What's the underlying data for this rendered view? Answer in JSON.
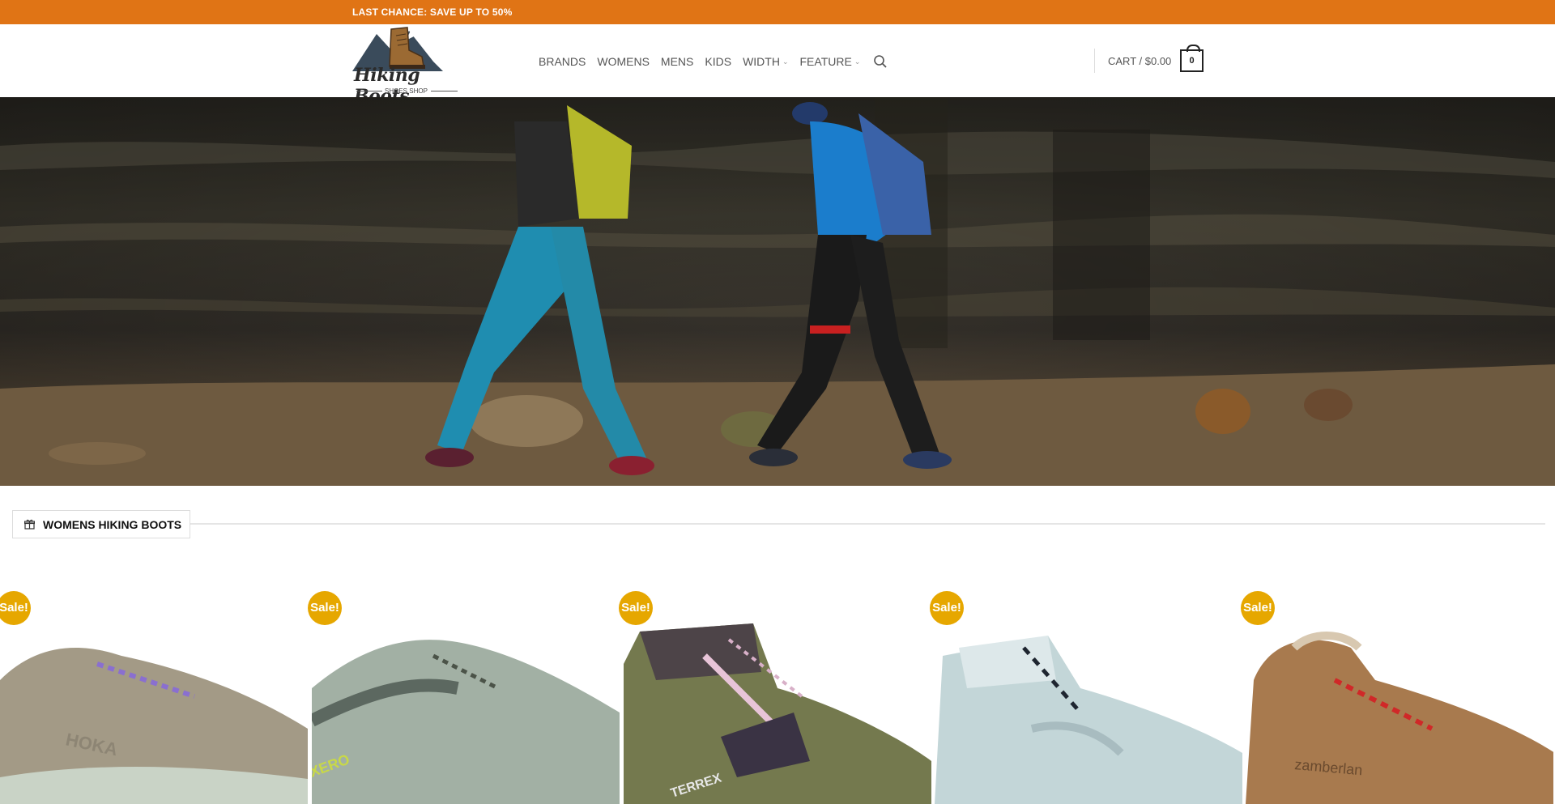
{
  "promo": {
    "text": "LAST CHANCE: SAVE UP TO 50%"
  },
  "logo": {
    "name": "Hiking Boots",
    "tagline": "SHOES SHOP"
  },
  "nav": {
    "items": [
      "BRANDS",
      "WOMENS",
      "MENS",
      "KIDS",
      "WIDTH",
      "FEATURE"
    ],
    "search_icon": "search-icon"
  },
  "cart": {
    "label": "CART / $0.00",
    "count": "0"
  },
  "section": {
    "title": "WOMENS HIKING BOOTS",
    "icon": "gift-icon"
  },
  "products": [
    {
      "badge": "Sale!",
      "brand_mark": "HOKA"
    },
    {
      "badge": "Sale!",
      "brand_mark": "XERO"
    },
    {
      "badge": "Sale!",
      "brand_mark": "TERREX"
    },
    {
      "badge": "Sale!",
      "brand_mark": ""
    },
    {
      "badge": "Sale!",
      "brand_mark": "zamberlan"
    }
  ],
  "colors": {
    "promo_bar": "#e07415",
    "sale_badge": "#e6a700",
    "text": "#555555"
  }
}
